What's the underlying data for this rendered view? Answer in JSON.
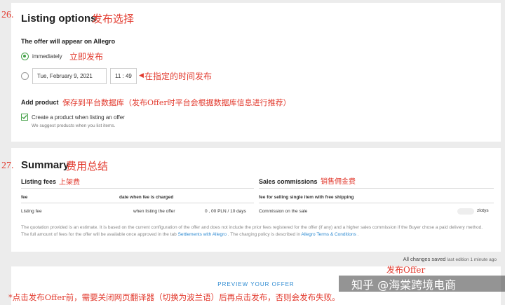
{
  "listing_options": {
    "step_number": "26.",
    "title": "Listing options",
    "title_cn": "发布选择",
    "offer_appear_label": "The offer will appear on Allegro",
    "option_immediately": "immediately",
    "option_immediately_cn": "立即发布",
    "date_value": "Tue, February 9, 2021",
    "time_value": "11 : 49",
    "scheduled_cn": "在指定的时间发布",
    "add_product_label": "Add product",
    "add_product_cn": "保存到平台数据库（发布Offer时平台会根据数据库信息进行推荐）",
    "create_product_label": "Create a product when listing an offer",
    "create_product_hint": "We suggest products when you list items."
  },
  "summary": {
    "step_number": "27.",
    "title": "Summary",
    "title_cn": "费用总结",
    "listing_fees": {
      "title": "Listing fees",
      "title_cn": "上架费",
      "columns": [
        "fee",
        "date when fee is charged"
      ],
      "row": {
        "fee": "Listing fee",
        "date": "when listing the offer",
        "amount": "0 , 00 PLN / 10 days"
      }
    },
    "sales_commissions": {
      "title": "Sales commissions",
      "title_cn": "销售佣金费",
      "column": "fee for selling single item with free shipping",
      "row": {
        "label": "Commission on the sale",
        "unit": "zlotys"
      }
    },
    "disclaimer_part1": "The quotation provided is an estimate. It is based on the current configuration of the offer and does not include the prior fees registered for the offer (if any) and a higher sales commission if the Buyer chose a paid delivery method. The full amount of fees for the offer will be available once approved in the tab",
    "disclaimer_link1": "Settlements with Allegro",
    "disclaimer_part2": ". The charging policy is described in",
    "disclaimer_link2": "Allegro Terms & Conditions",
    "disclaimer_part3": "."
  },
  "status": {
    "saved": "All changes saved",
    "last_edition": "last edition 1 minute ago"
  },
  "footer": {
    "preview_button": "PREVIEW YOUR OFFER",
    "publish_cn": "发布Offer",
    "note_cn": "*点击发布Offer前，需要关闭网页翻译器（切换为波兰语）后再点击发布，否则会发布失败。",
    "watermark": "知乎 @海棠跨境电商"
  },
  "colors": {
    "accent_green": "#43a047",
    "annotation_red": "#e23a2e",
    "link_blue": "#2d8ad1"
  }
}
